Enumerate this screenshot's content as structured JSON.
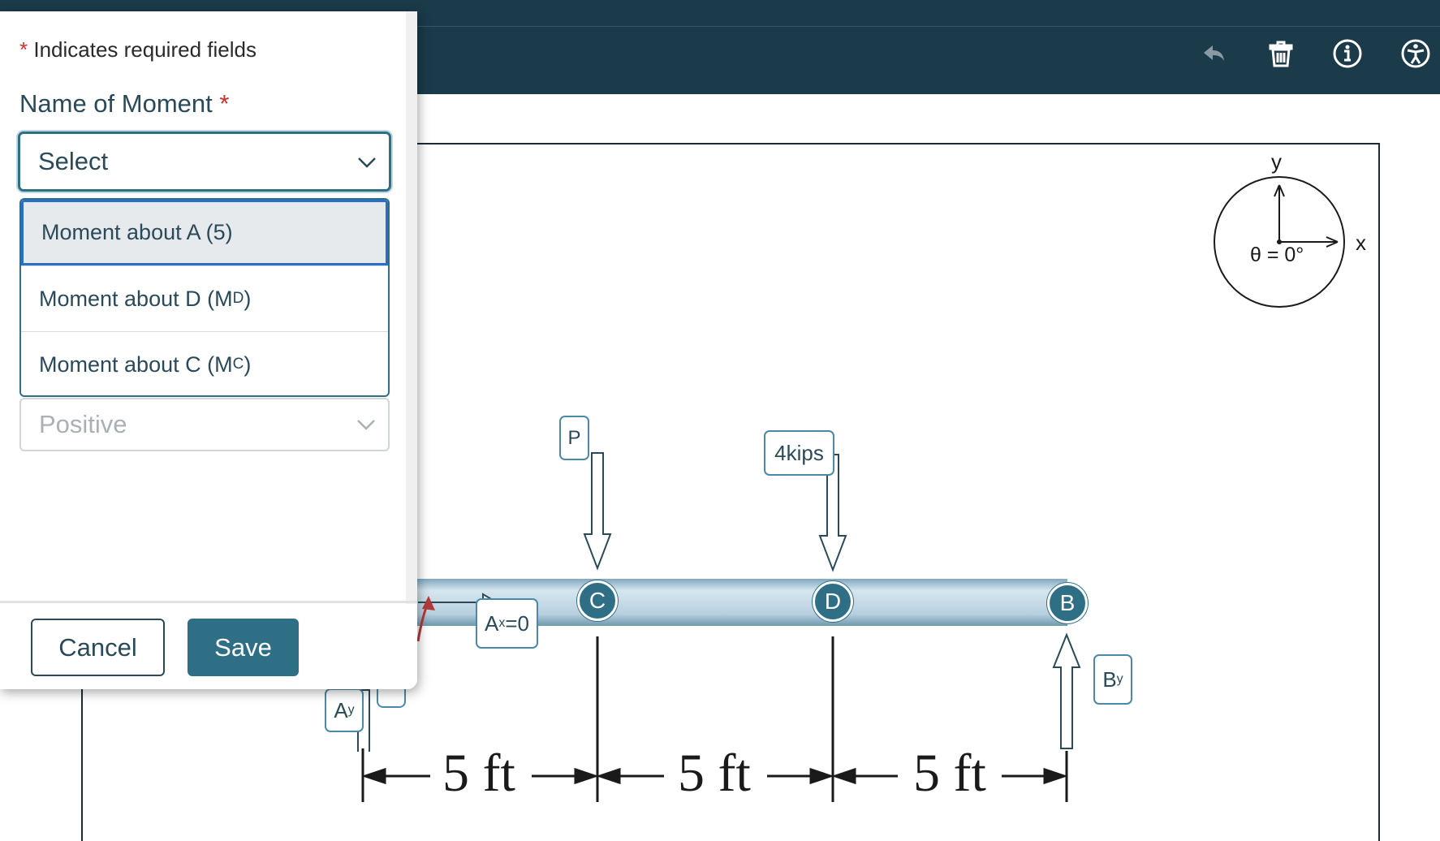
{
  "toolbar": {
    "icons": [
      "undo-icon",
      "trash-icon",
      "info-icon",
      "accessibility-icon"
    ]
  },
  "panel": {
    "required_note": "Indicates required fields",
    "required_star": "*",
    "field_label": "Name of Moment",
    "select_value": "Select",
    "options": [
      {
        "text": "Moment about A (5)",
        "sub": "",
        "suffix": ""
      },
      {
        "text": "Moment about D (M",
        "sub": "D",
        "suffix": ")"
      },
      {
        "text": "Moment about C (M",
        "sub": "C",
        "suffix": ")"
      }
    ],
    "sign_value": "Positive",
    "cancel_label": "Cancel",
    "save_label": "Save"
  },
  "diagram": {
    "axes": {
      "y_label": "y",
      "x_label": "x",
      "angle_label": "θ = 0°"
    },
    "loads": {
      "p_label": "P",
      "kips_label": "4kips"
    },
    "reactions": {
      "ax_base": "A",
      "ax_sub": "x",
      "ax_suffix": "=0",
      "ay_base": "A",
      "ay_sub": "y",
      "by_base": "B",
      "by_sub": "y"
    },
    "nodes": [
      "C",
      "D",
      "B"
    ],
    "dimensions": [
      "5 ft",
      "5 ft",
      "5 ft"
    ]
  },
  "colors": {
    "header": "#1b3a4a",
    "accent": "#2f6f86",
    "required": "#d0312d",
    "selected_border": "#2b6ec8"
  }
}
